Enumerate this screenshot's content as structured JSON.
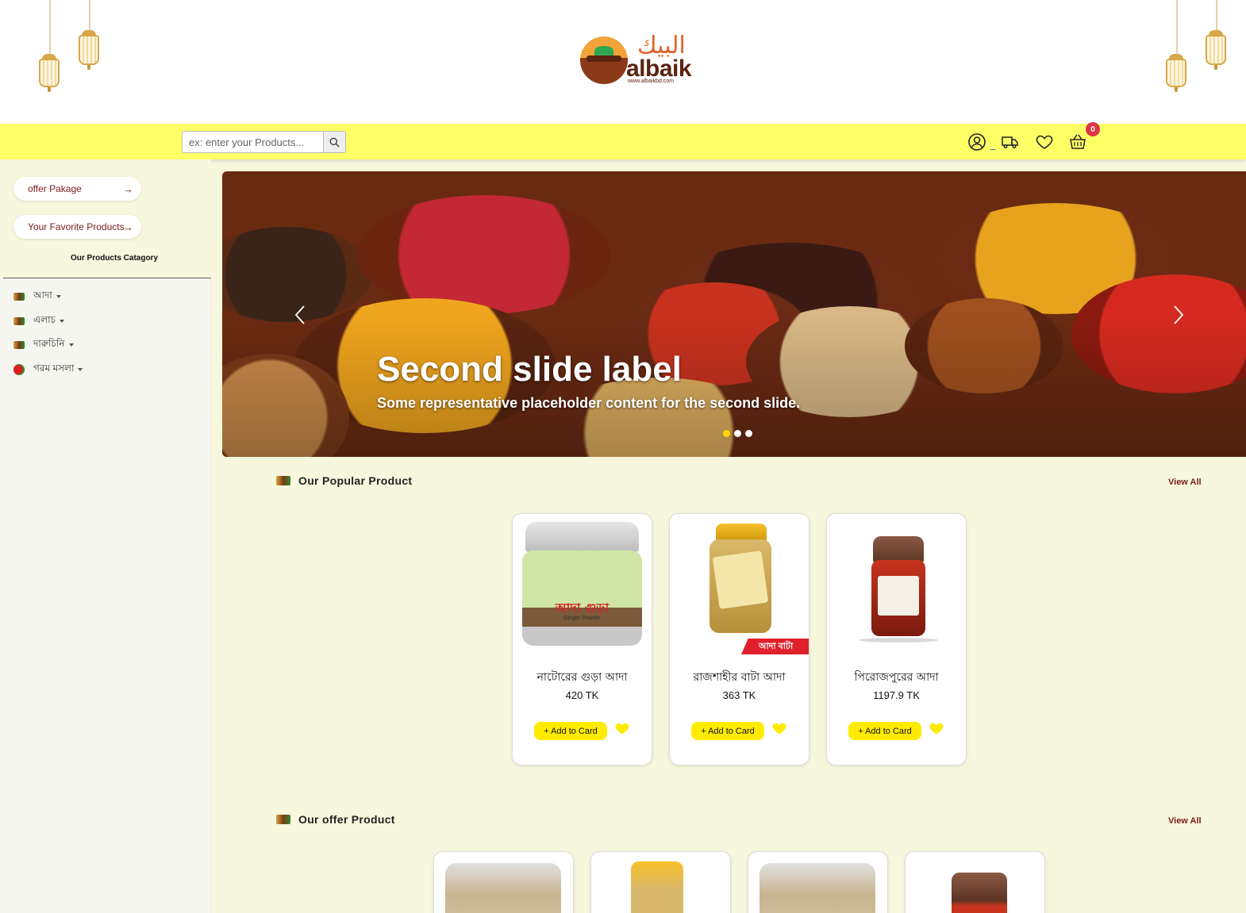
{
  "header": {
    "logo": {
      "arabic": "البيك",
      "latin": "albaik",
      "url": "www.albaikbd.com"
    }
  },
  "navbar": {
    "search_placeholder": "ex: enter your Products...",
    "icons": [
      "search-icon",
      "user-icon",
      "truck-icon",
      "heart-icon",
      "basket-icon"
    ],
    "cart_count": "0",
    "accent_color": "#ffff66"
  },
  "sidebar": {
    "offer_link": "offer Pakage",
    "favorite_link": "Your Favorite Products",
    "category_title": "Our Products Catagory",
    "categories": [
      {
        "label": "আদা"
      },
      {
        "label": "এলাচ"
      },
      {
        "label": "দারুচিনি"
      },
      {
        "label": "গরম মসলা"
      }
    ]
  },
  "carousel": {
    "title": "Second slide label",
    "caption": "Some representative placeholder content for the second slide.",
    "active_index": 1,
    "slide_count": 3
  },
  "popular": {
    "title": "Our Popular Product",
    "view_all": "View All",
    "products": [
      {
        "name": "নাটোরের গুড়া আদা",
        "price": "420 TK",
        "add_label": "+ Add to Card",
        "package_label": "আদা গুড়া",
        "package_sub": "Ginger Powder"
      },
      {
        "name": "রাজশাহীর বাটা আদা",
        "price": "363 TK",
        "add_label": "+ Add to Card",
        "ribbon": "আদা বাটা"
      },
      {
        "name": "পিরোজপুরের আদা",
        "price": "1197.9 TK",
        "add_label": "+ Add to Card"
      }
    ]
  },
  "offer": {
    "title": "Our offer Product",
    "view_all": "View All"
  }
}
